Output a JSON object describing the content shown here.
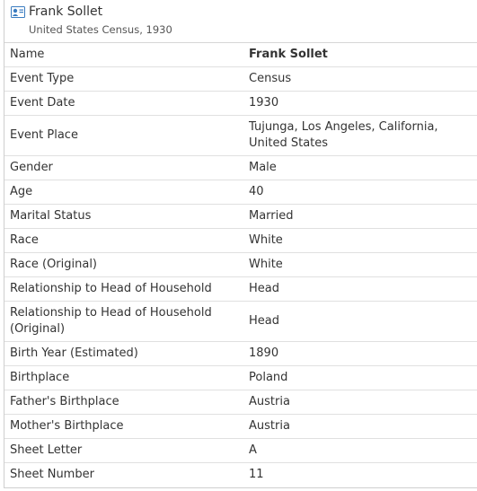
{
  "header": {
    "icon": "person-card-icon",
    "title": "Frank Sollet",
    "subtitle": "United States Census, 1930"
  },
  "rows": [
    {
      "label": "Name",
      "value": "Frank Sollet",
      "bold": true
    },
    {
      "label": "Event Type",
      "value": "Census"
    },
    {
      "label": "Event Date",
      "value": "1930"
    },
    {
      "label": "Event Place",
      "value": "Tujunga, Los Angeles, California, United States",
      "double": true
    },
    {
      "label": "Gender",
      "value": "Male"
    },
    {
      "label": "Age",
      "value": "40"
    },
    {
      "label": "Marital Status",
      "value": "Married"
    },
    {
      "label": "Race",
      "value": "White"
    },
    {
      "label": "Race (Original)",
      "value": "White"
    },
    {
      "label": "Relationship to Head of Household",
      "value": "Head"
    },
    {
      "label": "Relationship to Head of Household (Original)",
      "value": "Head",
      "double": true
    },
    {
      "label": "Birth Year (Estimated)",
      "value": "1890"
    },
    {
      "label": "Birthplace",
      "value": "Poland"
    },
    {
      "label": "Father's Birthplace",
      "value": "Austria"
    },
    {
      "label": "Mother's Birthplace",
      "value": "Austria"
    },
    {
      "label": "Sheet Letter",
      "value": "A"
    },
    {
      "label": "Sheet Number",
      "value": "11"
    }
  ]
}
